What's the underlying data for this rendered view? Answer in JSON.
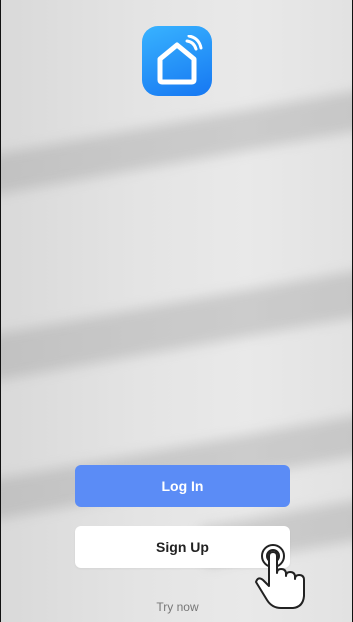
{
  "app": {
    "logo_icon": "smart-home-icon",
    "accent_color": "#5b8cf6"
  },
  "actions": {
    "login_label": "Log In",
    "signup_label": "Sign Up",
    "try_now_label": "Try now"
  },
  "overlay": {
    "pointer_icon": "hand-pointer-icon"
  }
}
